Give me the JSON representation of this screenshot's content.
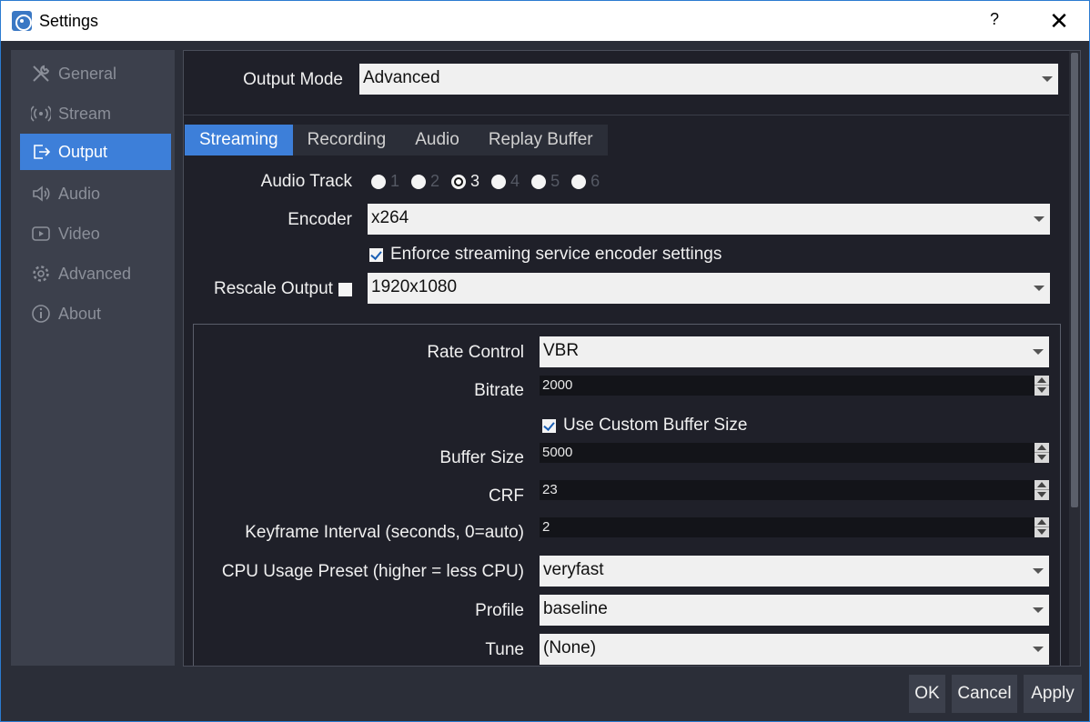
{
  "window": {
    "title": "Settings",
    "help": "?",
    "close": "✕"
  },
  "sidebar": {
    "items": [
      {
        "label": "General",
        "icon": "wrench-icon"
      },
      {
        "label": "Stream",
        "icon": "broadcast-icon"
      },
      {
        "label": "Output",
        "icon": "output-icon",
        "active": true
      },
      {
        "label": "Audio",
        "icon": "speaker-icon"
      },
      {
        "label": "Video",
        "icon": "play-icon"
      },
      {
        "label": "Advanced",
        "icon": "gear-icon"
      },
      {
        "label": "About",
        "icon": "info-icon"
      }
    ]
  },
  "output": {
    "mode_label": "Output Mode",
    "mode_value": "Advanced",
    "tabs": [
      "Streaming",
      "Recording",
      "Audio",
      "Replay Buffer"
    ],
    "audio_track_label": "Audio Track",
    "audio_tracks": [
      "1",
      "2",
      "3",
      "4",
      "5",
      "6"
    ],
    "audio_track_selected": "3",
    "encoder_label": "Encoder",
    "encoder_value": "x264",
    "enforce_label": "Enforce streaming service encoder settings",
    "rescale_label": "Rescale Output",
    "rescale_value": "1920x1080"
  },
  "encoder_settings": {
    "rate_control_label": "Rate Control",
    "rate_control_value": "VBR",
    "bitrate_label": "Bitrate",
    "bitrate_value": "2000",
    "custom_buffer_label": "Use Custom Buffer Size",
    "buffer_size_label": "Buffer Size",
    "buffer_size_value": "5000",
    "crf_label": "CRF",
    "crf_value": "23",
    "keyframe_label": "Keyframe Interval (seconds, 0=auto)",
    "keyframe_value": "2",
    "cpu_preset_label": "CPU Usage Preset (higher = less CPU)",
    "cpu_preset_value": "veryfast",
    "profile_label": "Profile",
    "profile_value": "baseline",
    "tune_label": "Tune",
    "tune_value": "(None)"
  },
  "footer": {
    "ok": "OK",
    "cancel": "Cancel",
    "apply": "Apply"
  }
}
